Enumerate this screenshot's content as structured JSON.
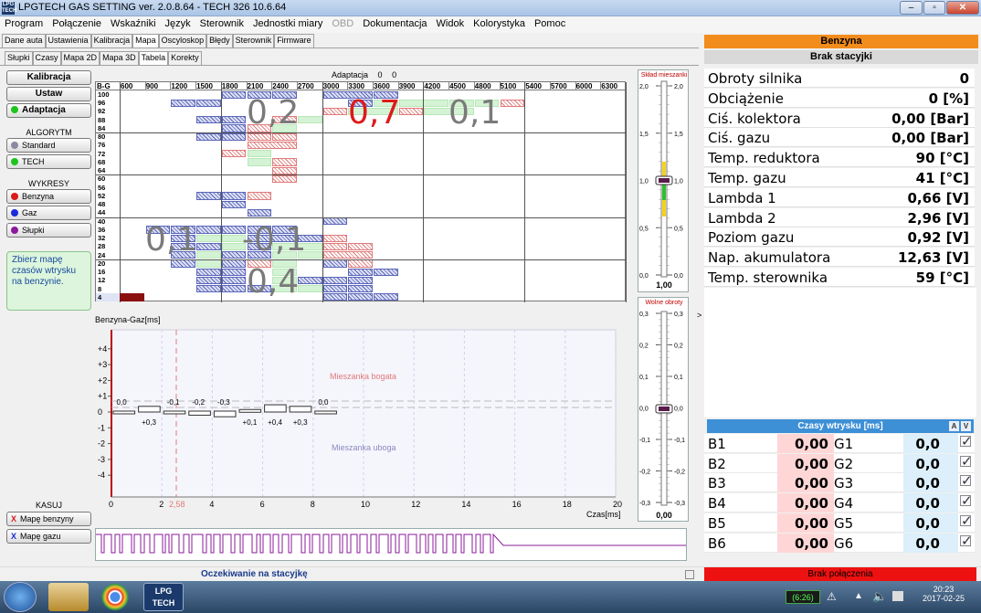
{
  "app": {
    "title": "LPGTECH GAS SETTING ver. 2.0.8.64  -  TECH 326   10.6.64",
    "logo": "LPG TECH"
  },
  "window_controls": {
    "minimize": "–",
    "maximize": "▫",
    "close": "✕"
  },
  "menu": [
    "Program",
    "Połączenie",
    "Wskaźniki",
    "Język",
    "Sterownik",
    "Jednostki miary",
    "OBD",
    "Dokumentacja",
    "Widok",
    "Kolorystyka",
    "Pomoc"
  ],
  "menu_disabled": [
    "OBD"
  ],
  "main_tabs": [
    "Dane auta",
    "Ustawienia",
    "Kalibracja",
    "Mapa",
    "Oscyloskop",
    "Błędy",
    "Sterownik",
    "Firmware"
  ],
  "main_tabs_active": "Mapa",
  "sub_tabs": [
    "Słupki",
    "Czasy",
    "Mapa 2D",
    "Mapa 3D",
    "Tabela",
    "Korekty"
  ],
  "sub_tabs_active": "Tabela",
  "left_buttons": {
    "kalibracja": "Kalibracja",
    "ustaw": "Ustaw",
    "adaptacja": "Adaptacja"
  },
  "algorytm": {
    "title": "ALGORYTM",
    "standard": "Standard",
    "tech": "TECH"
  },
  "wykresy": {
    "title": "WYKRESY",
    "benzyna": "Benzyna",
    "gaz": "Gaz",
    "slupki": "Słupki"
  },
  "note": "Zbierz mapę czasów wtrysku na benzynie.",
  "kasuj": {
    "title": "KASUJ",
    "benzyny": "Mapę benzyny",
    "gazu": "Mapę gazu",
    "mark": "X"
  },
  "map_table": {
    "title": "Adaptacja",
    "title_values": [
      "0",
      "0"
    ],
    "corner": "B-G",
    "columns": [
      "600",
      "900",
      "1200",
      "1500",
      "1800",
      "2100",
      "2400",
      "2700",
      "3000",
      "3300",
      "3600",
      "3900",
      "4200",
      "4500",
      "4800",
      "5100",
      "5400",
      "5700",
      "6000",
      "6300"
    ],
    "rows": [
      "100",
      "96",
      "92",
      "88",
      "84",
      "80",
      "76",
      "72",
      "68",
      "64",
      "60",
      "56",
      "52",
      "48",
      "44",
      "40",
      "36",
      "32",
      "28",
      "24",
      "20",
      "16",
      "12",
      "8",
      "4"
    ],
    "zone_values": [
      "0,2",
      "0,7",
      "0,1",
      "0,1",
      "-0,1",
      "0,4"
    ]
  },
  "graph": {
    "ylabel": "Benzyna-Gaz[ms]",
    "xlabel": "Czas[ms]",
    "yticks": [
      "+4",
      "+3",
      "+2",
      "+1",
      "0",
      "-1",
      "-2",
      "-3",
      "-4"
    ],
    "xticks": [
      "0",
      "2",
      "4",
      "6",
      "8",
      "10",
      "12",
      "14",
      "16",
      "18",
      "20"
    ],
    "marker": "2,58",
    "rich": "Mieszanka bogata",
    "lean": "Mieszanka uboga",
    "bar_labels_top": [
      "0,0",
      "-0,1",
      "-0,2",
      "-0,3",
      "0,0"
    ],
    "bar_labels_bottom": [
      "+0,3",
      "+0,1",
      "+0,4",
      "+0,3"
    ]
  },
  "gauge1": {
    "title": "Skład mieszanki",
    "ticks": [
      "2,0",
      "1,5",
      "1,0",
      "0,5",
      "0,0"
    ],
    "value": "1,00"
  },
  "gauge2": {
    "title": "Wolne obroty",
    "ticks": [
      "0,3",
      "0,2",
      "0,1",
      "0,0",
      "-0,1",
      "-0,2",
      "-0,3"
    ],
    "value": "0,00"
  },
  "right_panel": {
    "fuel": "Benzyna",
    "status": "Brak stacyjki",
    "params": [
      {
        "k": "Obroty silnika",
        "v": "0"
      },
      {
        "k": "Obciążenie",
        "v": "0 [%]"
      },
      {
        "k": "Ciś. kolektora",
        "v": "0,00 [Bar]"
      },
      {
        "k": "Ciś. gazu",
        "v": "0,00 [Bar]"
      },
      {
        "k": "Temp. reduktora",
        "v": "90 [°C]"
      },
      {
        "k": "Temp. gazu",
        "v": "41 [°C]"
      },
      {
        "k": "Lambda 1",
        "v": "0,66 [V]"
      },
      {
        "k": "Lambda 2",
        "v": "2,96 [V]"
      },
      {
        "k": "Poziom gazu",
        "v": "0,92 [V]"
      },
      {
        "k": "Nap. akumulatora",
        "v": "12,63 [V]"
      },
      {
        "k": "Temp. sterownika",
        "v": "59 [°C]"
      }
    ],
    "injection_title": "Czasy wtrysku [ms]",
    "injection_btns": [
      "A",
      "V"
    ],
    "injection": [
      {
        "b": "B1",
        "bv": "0,00",
        "g": "G1",
        "gv": "0,0"
      },
      {
        "b": "B2",
        "bv": "0,00",
        "g": "G2",
        "gv": "0,0"
      },
      {
        "b": "B3",
        "bv": "0,00",
        "g": "G3",
        "gv": "0,0"
      },
      {
        "b": "B4",
        "bv": "0,00",
        "g": "G4",
        "gv": "0,0"
      },
      {
        "b": "B5",
        "bv": "0,00",
        "g": "G5",
        "gv": "0,0"
      },
      {
        "b": "B6",
        "bv": "0,00",
        "g": "G6",
        "gv": "0,0"
      }
    ],
    "check": "✓",
    "collapse_arrow": ">"
  },
  "statusbar": {
    "center": "Oczekiwanie na stacyjkę",
    "right": "Brak połączenia"
  },
  "taskbar": {
    "battery": "(6:26)",
    "time": "20:23",
    "date": "2017-02-25",
    "lpg_icon": "LPG TECH"
  },
  "colors": {
    "orange": "#f28c1c",
    "red": "#ee1111",
    "injection_blue": "#3d8fd6",
    "gas_pink": "#ffd6d6",
    "gas_cyan": "#dceffa"
  }
}
